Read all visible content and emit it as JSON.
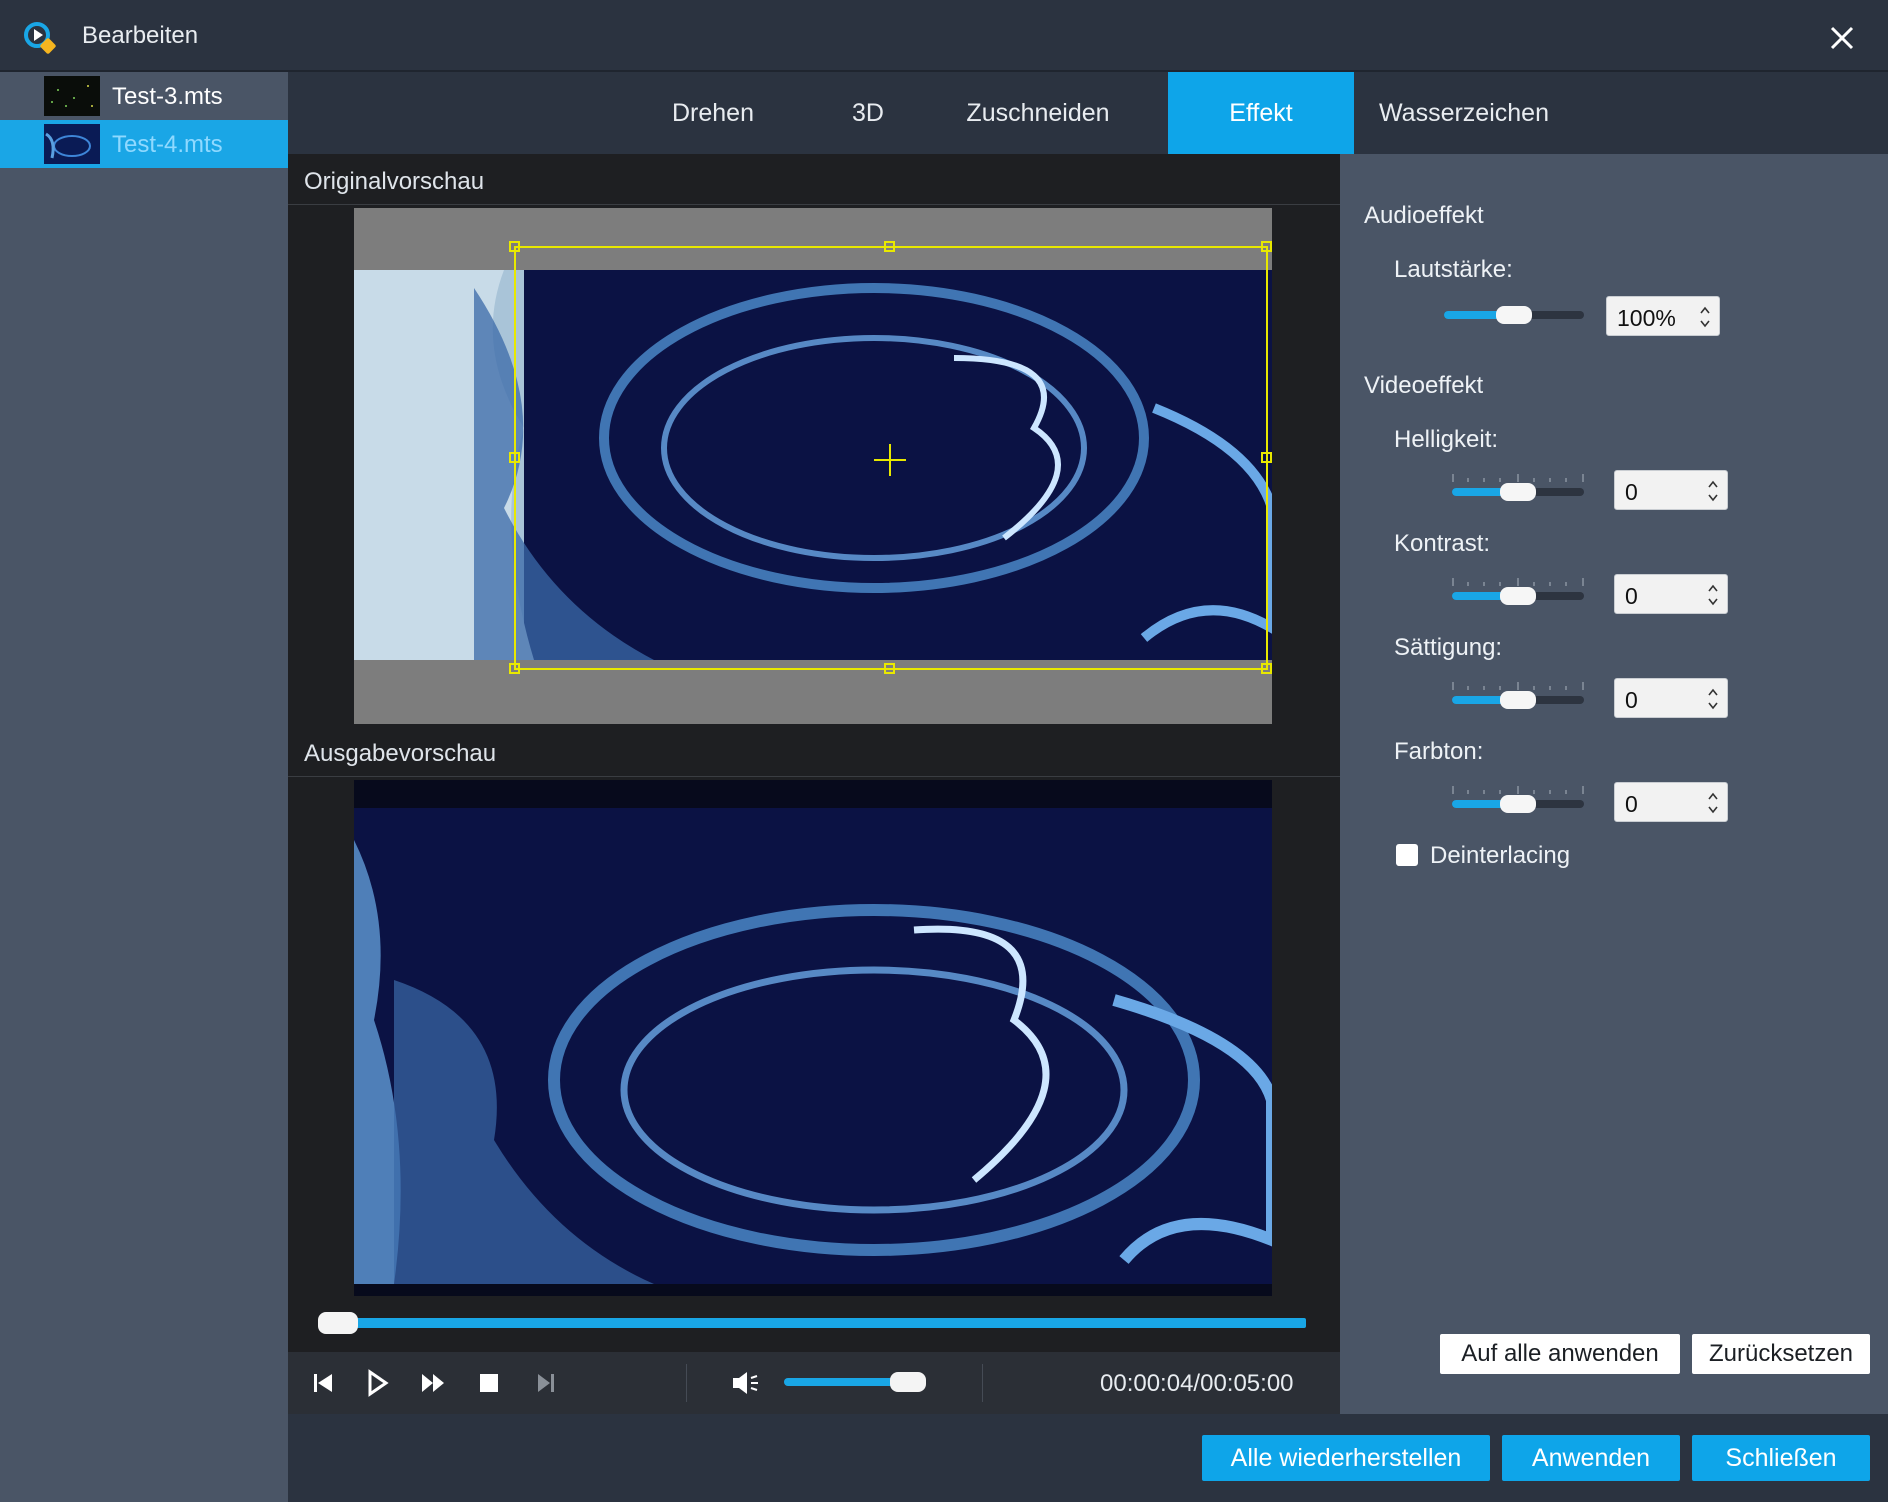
{
  "window": {
    "title": "Bearbeiten"
  },
  "files": [
    {
      "name": "Test-3.mts"
    },
    {
      "name": "Test-4.mts",
      "selected": true
    }
  ],
  "tabs": {
    "rotate": "Drehen",
    "three_d": "3D",
    "crop": "Zuschneiden",
    "effect": "Effekt",
    "watermark": "Wasserzeichen",
    "active": "Effekt"
  },
  "preview": {
    "original_title": "Originalvorschau",
    "output_title": "Ausgabevorschau",
    "progress_fraction": 0.01,
    "volume_fraction": 0.8,
    "timecode": "00:00:04/00:05:00"
  },
  "settings": {
    "audio_heading": "Audioeffekt",
    "volume_label": "Lautstärke:",
    "volume_value": "100%",
    "video_heading": "Videoeffekt",
    "brightness_label": "Helligkeit:",
    "brightness_value": "0",
    "contrast_label": "Kontrast:",
    "contrast_value": "0",
    "saturation_label": "Sättigung:",
    "saturation_value": "0",
    "hue_label": "Farbton:",
    "hue_value": "0",
    "deinterlacing_label": "Deinterlacing",
    "deinterlacing_checked": false,
    "apply_all": "Auf alle anwenden",
    "reset": "Zurücksetzen"
  },
  "footer": {
    "restore_all": "Alle wiederherstellen",
    "apply": "Anwenden",
    "close": "Schließen"
  },
  "colors": {
    "accent": "#0ea5e9",
    "crop_box": "#e8e800",
    "panel": "#4a5566",
    "dark_bg": "#2b3340"
  }
}
